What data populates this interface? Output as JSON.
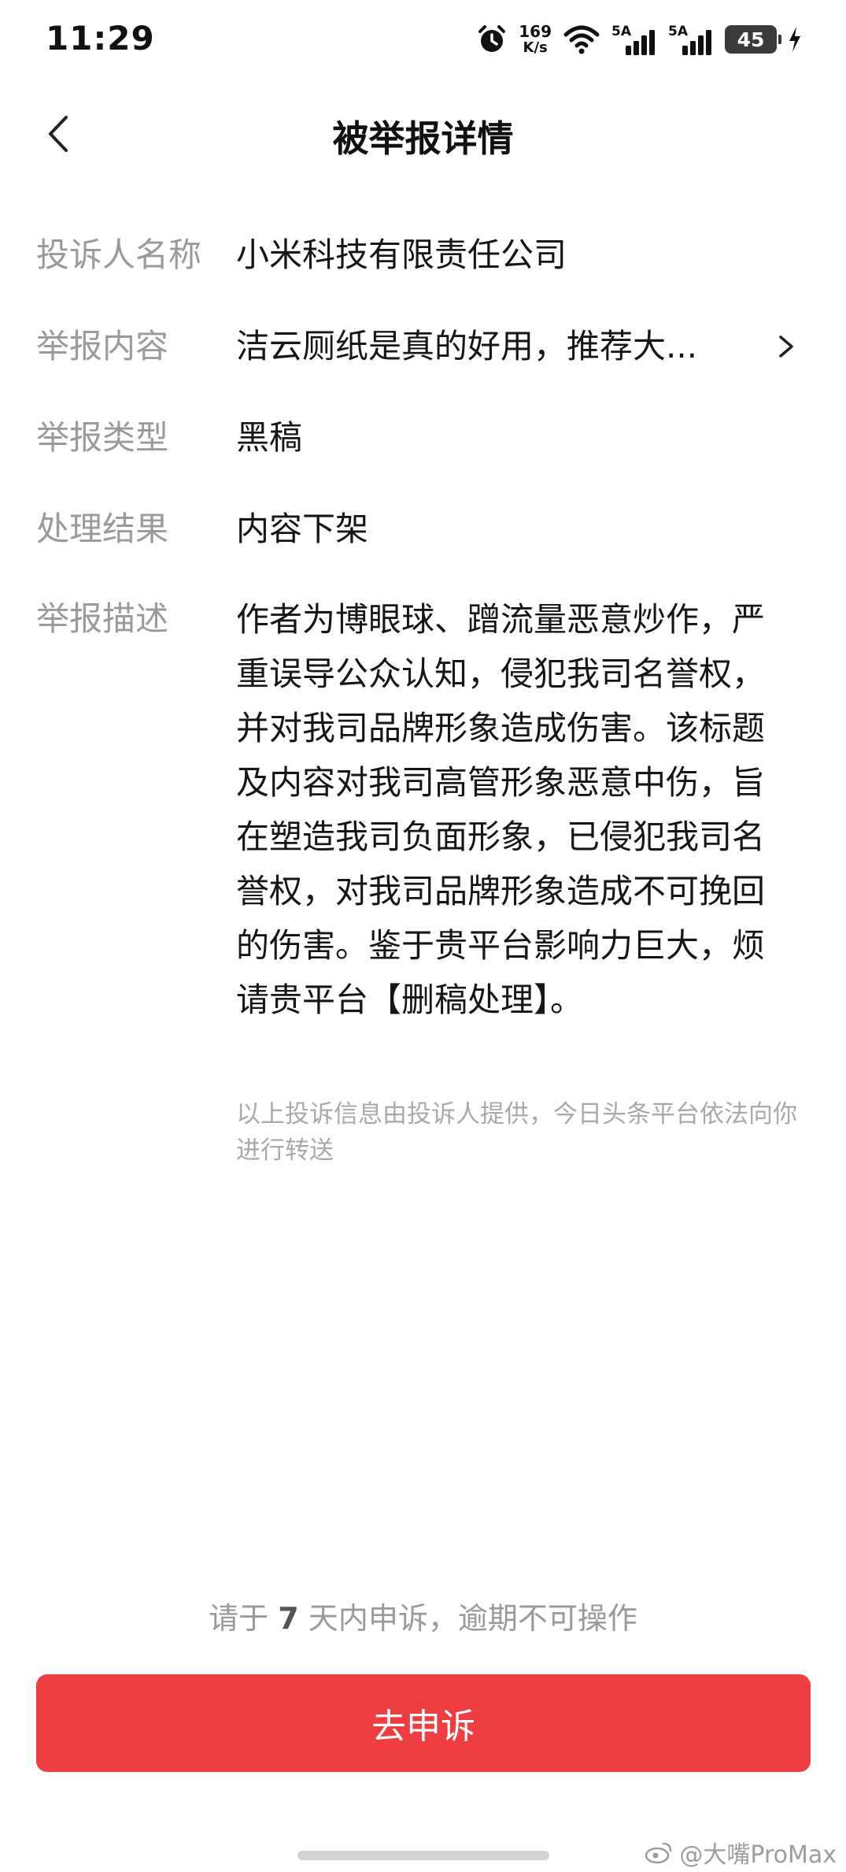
{
  "status_bar": {
    "time": "11:29",
    "net_speed_value": "169",
    "net_speed_unit": "K/s",
    "sim1_tag": "5A",
    "sim2_tag": "5A",
    "battery_level": "45"
  },
  "nav": {
    "title": "被举报详情"
  },
  "details": {
    "complainant": {
      "label": "投诉人名称",
      "value": "小米科技有限责任公司"
    },
    "content": {
      "label": "举报内容",
      "value": "洁云厕纸是真的好用，推荐大..."
    },
    "type": {
      "label": "举报类型",
      "value": "黑稿"
    },
    "result": {
      "label": "处理结果",
      "value": "内容下架"
    },
    "description": {
      "label": "举报描述",
      "value": "作者为博眼球、蹭流量恶意炒作，严重误导公众认知，侵犯我司名誉权，并对我司品牌形象造成伤害。该标题及内容对我司高管形象恶意中伤，旨在塑造我司负面形象，已侵犯我司名誉权，对我司品牌形象造成不可挽回的伤害。鉴于贵平台影响力巨大，烦请贵平台【删稿处理】。"
    }
  },
  "notice": "以上投诉信息由投诉人提供，今日头条平台依法向你进行转送",
  "deadline": {
    "prefix": "请于",
    "days": "7",
    "suffix": "天内申诉，逾期不可操作"
  },
  "appeal_button": "去申诉",
  "watermark": "@大嘴ProMax",
  "colors": {
    "accent": "#ee3e42",
    "label_gray": "#9a9a9a",
    "text": "#161616"
  }
}
